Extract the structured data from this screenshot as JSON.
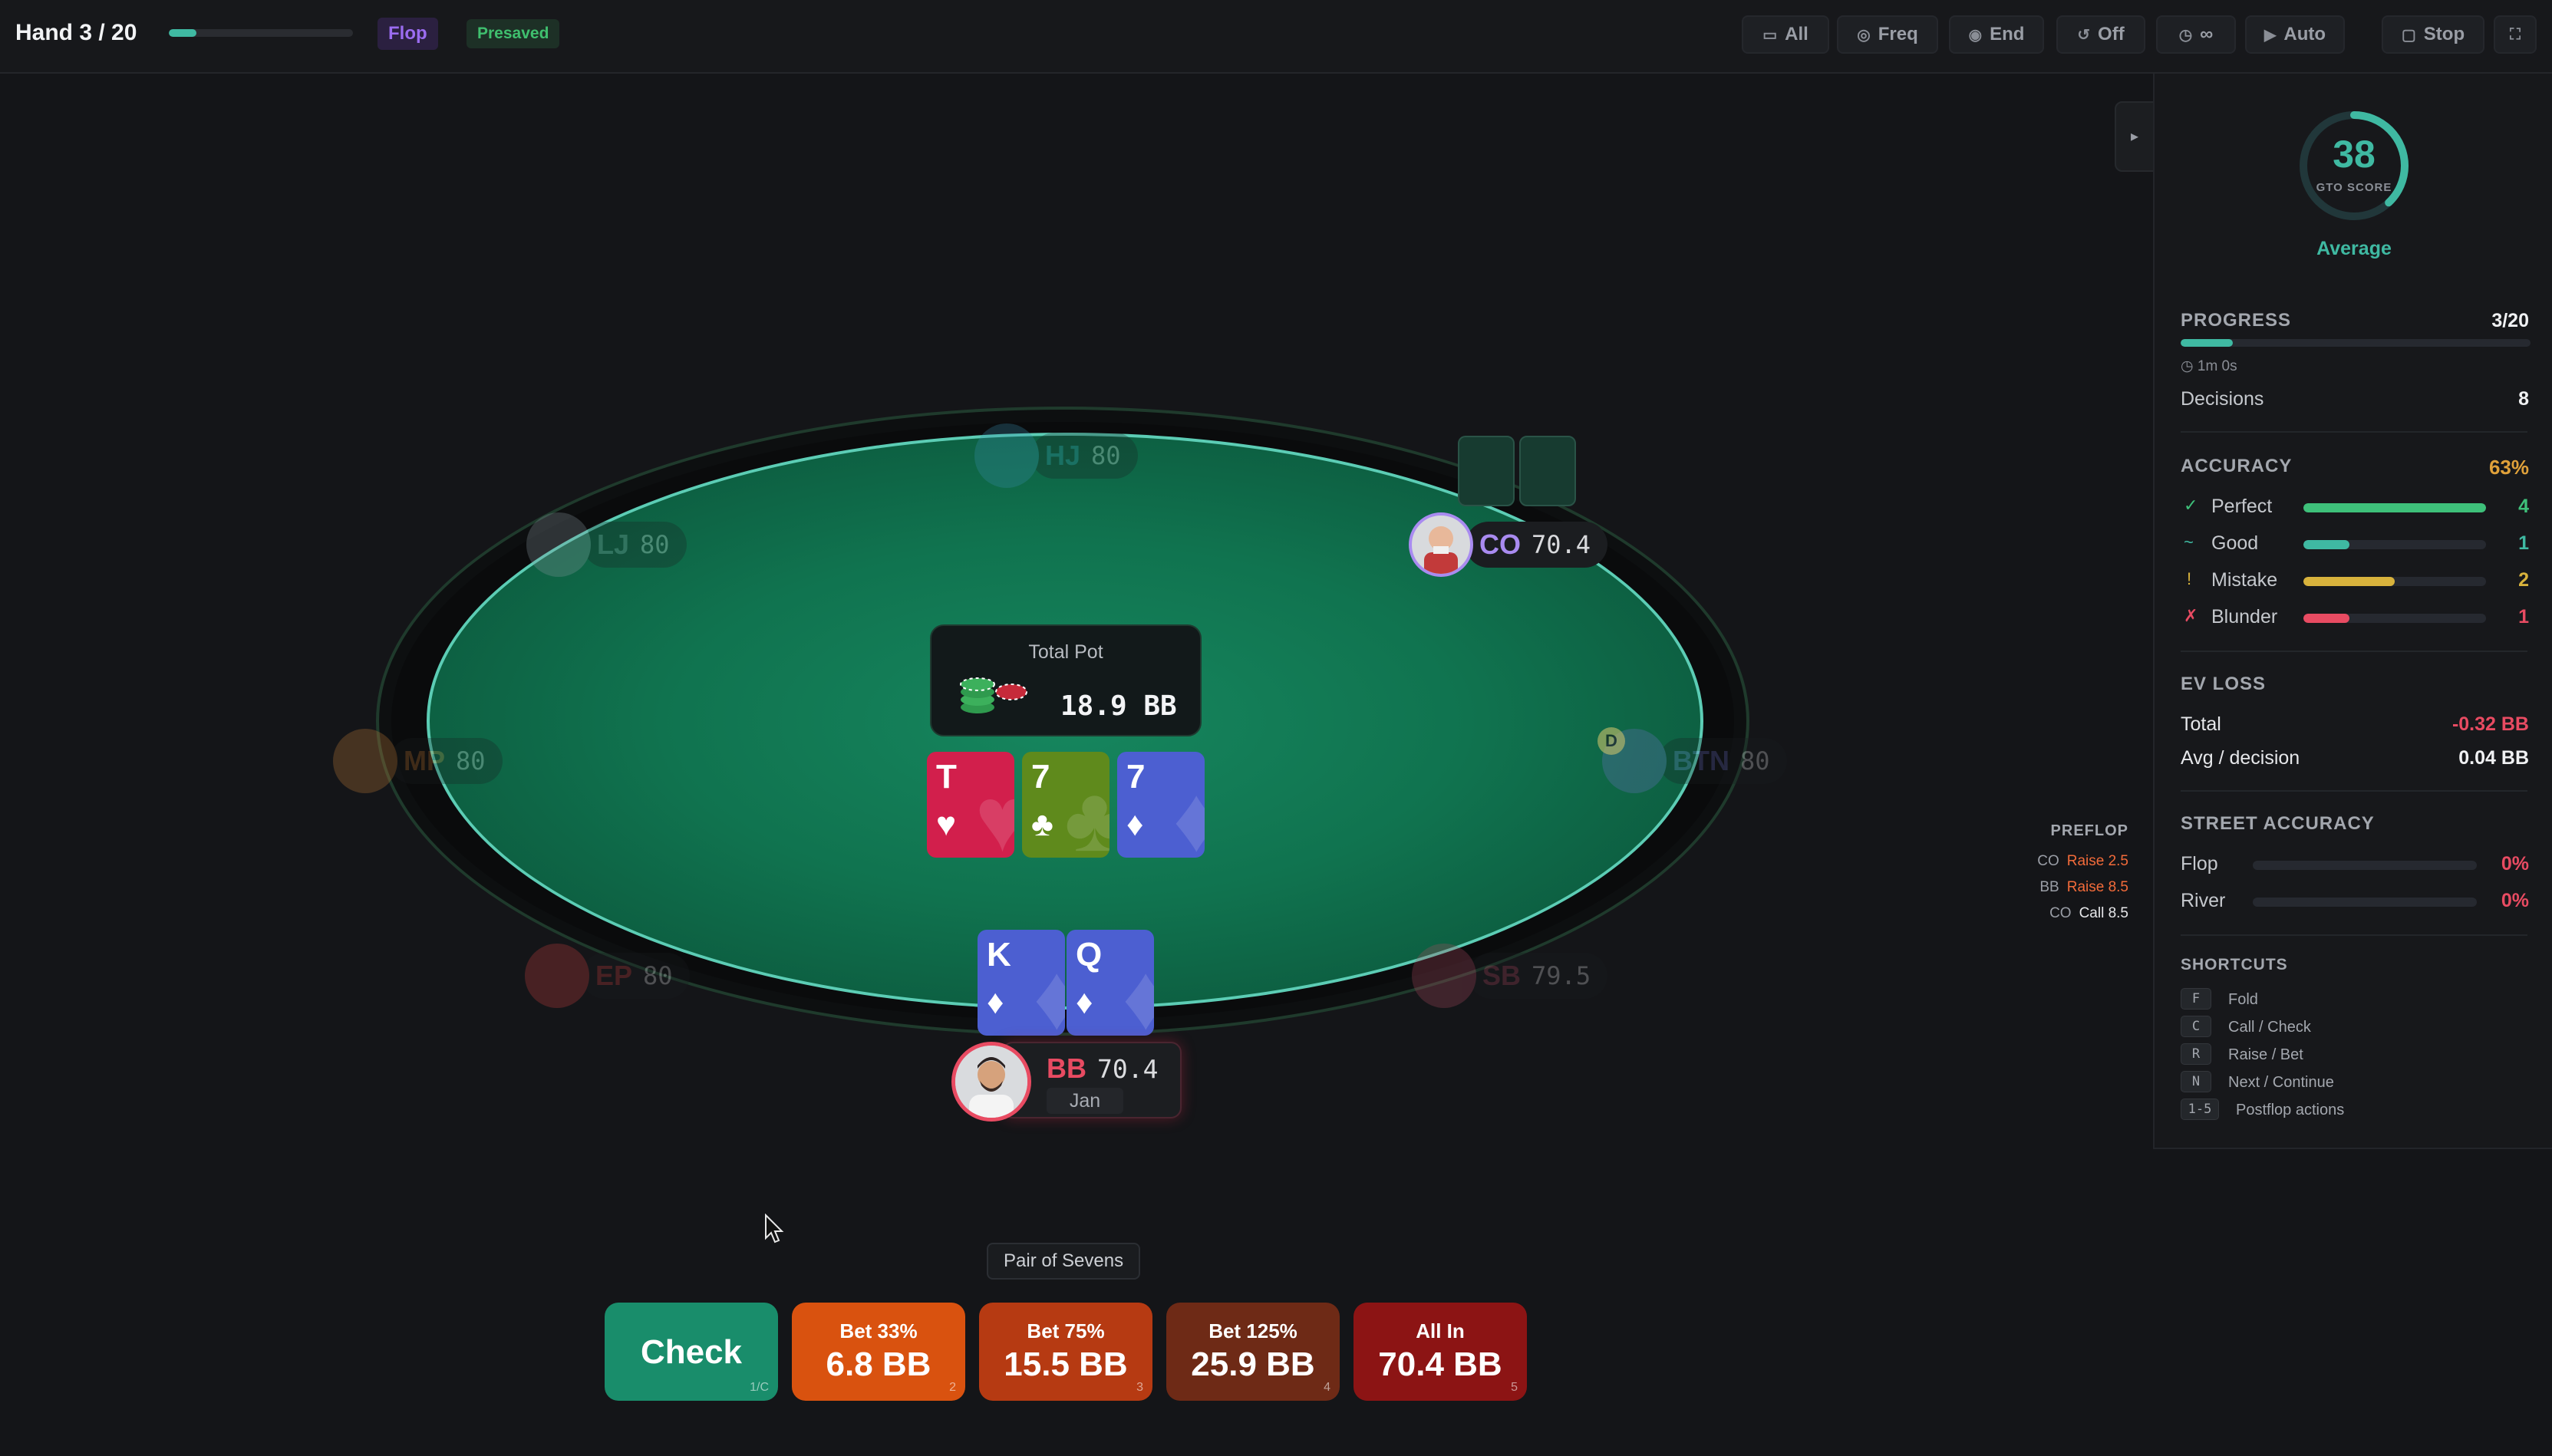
{
  "header": {
    "hand_title": "Hand 3 / 20",
    "hand_progress": 0.15,
    "street": "Flop",
    "presaved": "Presaved",
    "buttons": [
      {
        "id": "all",
        "icon": "chat-icon",
        "glyph": "▭",
        "label": "All"
      },
      {
        "id": "freq",
        "icon": "target-icon",
        "glyph": "◎",
        "label": "Freq"
      },
      {
        "id": "end",
        "icon": "eye-icon",
        "glyph": "◉",
        "label": "End"
      },
      {
        "id": "off",
        "icon": "history-icon",
        "glyph": "↺",
        "label": "Off"
      },
      {
        "id": "timer",
        "icon": "clock-icon",
        "glyph": "◷",
        "label": "∞"
      },
      {
        "id": "auto",
        "icon": "play-icon",
        "glyph": "▶",
        "label": "Auto"
      },
      {
        "id": "stop",
        "icon": "stop-icon",
        "glyph": "▢",
        "label": "Stop"
      },
      {
        "id": "fullscreen",
        "icon": "fullscreen-icon",
        "glyph": "⛶",
        "label": ""
      }
    ]
  },
  "table": {
    "seats": [
      {
        "pos": "HJ",
        "stack": "80",
        "active": false,
        "color": "#3a8fb0"
      },
      {
        "pos": "LJ",
        "stack": "80",
        "active": false,
        "color": "#8d9aa3"
      },
      {
        "pos": "MP",
        "stack": "80",
        "active": false,
        "color": "#c9803a"
      },
      {
        "pos": "EP",
        "stack": "80",
        "active": false,
        "color": "#d04040"
      },
      {
        "pos": "SB",
        "stack": "79.5",
        "active": false,
        "color": "#b04a62"
      },
      {
        "pos": "BTN",
        "stack": "80",
        "active": false,
        "color": "#6f74c9",
        "dealer": "D"
      },
      {
        "pos": "CO",
        "stack": "70.4",
        "active": true,
        "color": "#a98bf0"
      }
    ],
    "pot": {
      "label": "Total Pot",
      "value": "18.9 BB"
    },
    "board": [
      {
        "rank": "T",
        "suit": "♥",
        "suit_name": "hearts"
      },
      {
        "rank": "7",
        "suit": "♣",
        "suit_name": "clubs"
      },
      {
        "rank": "7",
        "suit": "♦",
        "suit_name": "diamonds"
      }
    ],
    "hero": {
      "pos": "BB",
      "stack": "70.4",
      "name": "Jan",
      "cards": [
        {
          "rank": "K",
          "suit": "♦",
          "suit_name": "diamonds"
        },
        {
          "rank": "Q",
          "suit": "♦",
          "suit_name": "diamonds"
        }
      ]
    }
  },
  "history": {
    "title": "PREFLOP",
    "rows": [
      {
        "who": "CO",
        "action": "Raise 2.5",
        "color": "#f26b3a"
      },
      {
        "who": "BB",
        "action": "Raise 8.5",
        "color": "#f26b3a"
      },
      {
        "who": "CO",
        "action": "Call 8.5",
        "color": "#e6e7ea"
      }
    ]
  },
  "hand_strength": "Pair of Sevens",
  "actions": [
    {
      "top": "",
      "big": "Check",
      "key": "1/C",
      "color": "#198d6b"
    },
    {
      "top": "Bet 33%",
      "big": "6.8 BB",
      "key": "2",
      "color": "#d9520f"
    },
    {
      "top": "Bet 75%",
      "big": "15.5 BB",
      "key": "3",
      "color": "#b63a12"
    },
    {
      "top": "Bet 125%",
      "big": "25.9 BB",
      "key": "4",
      "color": "#6e2a16"
    },
    {
      "top": "All In",
      "big": "70.4 BB",
      "key": "5",
      "color": "#8c1414"
    }
  ],
  "panel": {
    "score": {
      "value": "38",
      "label": "GTO SCORE",
      "rating": "Average",
      "fraction": 0.38
    },
    "progress": {
      "label": "PROGRESS",
      "value": "3/20",
      "fraction": 0.15,
      "time": "1m 0s",
      "decisions_label": "Decisions",
      "decisions": "8"
    },
    "accuracy": {
      "label": "ACCURACY",
      "value": "63%",
      "rows": [
        {
          "mark": "✓",
          "label": "Perfect",
          "count": "4",
          "fraction": 1.0,
          "color": "#3ec07a"
        },
        {
          "mark": "~",
          "label": "Good",
          "count": "1",
          "fraction": 0.25,
          "color": "#3fb9a2"
        },
        {
          "mark": "!",
          "label": "Mistake",
          "count": "2",
          "fraction": 0.5,
          "color": "#d8b23c"
        },
        {
          "mark": "✗",
          "label": "Blunder",
          "count": "1",
          "fraction": 0.25,
          "color": "#e84b62"
        }
      ]
    },
    "ev_loss": {
      "label": "EV LOSS",
      "total_label": "Total",
      "total": "-0.32 BB",
      "avg_label": "Avg / decision",
      "avg": "0.04 BB"
    },
    "street_accuracy": {
      "label": "STREET ACCURACY",
      "rows": [
        {
          "label": "Flop",
          "value": "0%"
        },
        {
          "label": "River",
          "value": "0%"
        }
      ]
    },
    "shortcuts": {
      "label": "SHORTCUTS",
      "rows": [
        {
          "key": "F",
          "label": "Fold"
        },
        {
          "key": "C",
          "label": "Call / Check"
        },
        {
          "key": "R",
          "label": "Raise / Bet"
        },
        {
          "key": "N",
          "label": "Next / Continue"
        },
        {
          "key": "1-5",
          "label": "Postflop actions"
        }
      ]
    }
  },
  "colors": {
    "accent": "#3fb9a2",
    "felt": "#10734f",
    "rail_line": "#5ccdb5",
    "hero": "#e84b62",
    "co": "#a98bf0",
    "ev_negative": "#e84b62",
    "accuracy": "#e0a13a"
  }
}
